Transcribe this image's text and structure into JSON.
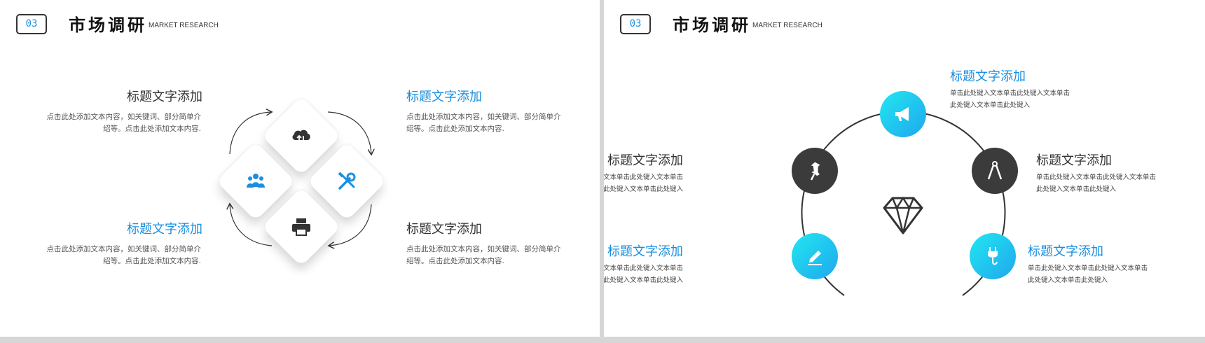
{
  "slides": [
    {
      "badge": "03",
      "title": "市场调研",
      "subtitle": "MARKET RESEARCH",
      "blocks": [
        {
          "title": "标题文字添加",
          "body": "点击此处添加文本内容，如关键词、部分简单介绍等。点击此处添加文本内容."
        },
        {
          "title": "标题文字添加",
          "body": "点击此处添加文本内容，如关键词、部分简单介绍等。点击此处添加文本内容."
        },
        {
          "title": "标题文字添加",
          "body": "点击此处添加文本内容，如关键词、部分简单介绍等。点击此处添加文本内容."
        },
        {
          "title": "标题文字添加",
          "body": "点击此处添加文本内容，如关键词、部分简单介绍等。点击此处添加文本内容."
        }
      ],
      "icons": [
        "cloud-transfer-icon",
        "team-icon",
        "tools-icon",
        "printer-icon"
      ]
    },
    {
      "badge": "03",
      "title": "市场调研",
      "subtitle": "MARKET RESEARCH",
      "blocks": [
        {
          "title": "标题文字添加",
          "body": "单击此处键入文本单击此处键入文本单击此处键入文本单击此处键入"
        },
        {
          "title": "标题文字添加",
          "body": "单击此处键入文本单击此处键入文本单击此处键入文本单击此处键入"
        },
        {
          "title": "标题文字添加",
          "body": "单击此处键入文本单击此处键入文本单击此处键入文本单击此处键入"
        },
        {
          "title": "标题文字添加",
          "body": "单击此处键入文本单击此处键入文本单击此处键入文本单击此处键入"
        },
        {
          "title": "标题文字添加",
          "body": "单击此处键入文本单击此处键入文本单击此处键入文本单击此处键入"
        }
      ],
      "icons": [
        "megaphone-icon",
        "pushpin-icon",
        "compass-icon",
        "edit-icon",
        "plug-icon",
        "diamond-icon"
      ]
    }
  ],
  "colors": {
    "accent": "#1a8fe0",
    "dark": "#333333",
    "gradient_start": "#22e7ef",
    "gradient_end": "#1fa7ef"
  }
}
